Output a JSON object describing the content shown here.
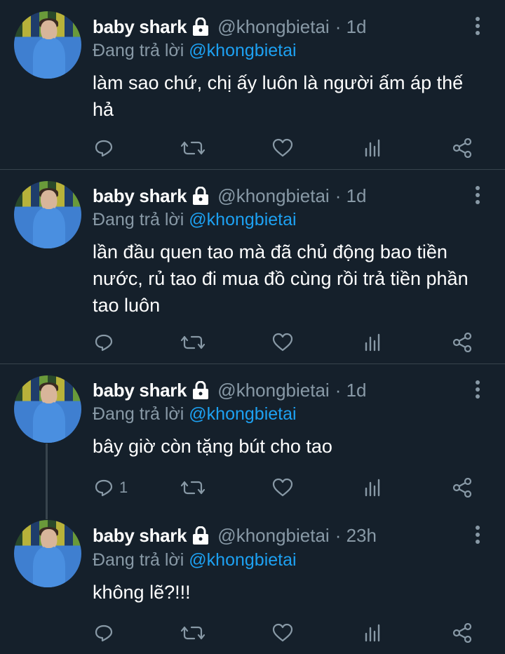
{
  "tweets": [
    {
      "name": "baby shark",
      "handle": "@khongbietai",
      "time": "· 1d",
      "reply_prefix": "Đang trả lời",
      "reply_to": "@khongbietai",
      "text": "làm sao chứ, chị ấy luôn là người ấm áp thế hả",
      "reply_count": ""
    },
    {
      "name": "baby shark",
      "handle": "@khongbietai",
      "time": "· 1d",
      "reply_prefix": "Đang trả lời",
      "reply_to": "@khongbietai",
      "text": "lần đầu quen tao mà đã chủ động bao tiền nước, rủ tao đi mua đồ cùng rồi trả tiền phần tao luôn",
      "reply_count": ""
    },
    {
      "name": "baby shark",
      "handle": "@khongbietai",
      "time": "· 1d",
      "reply_prefix": "Đang trả lời",
      "reply_to": "@khongbietai",
      "text": "bây giờ còn tặng bút cho tao",
      "reply_count": "1"
    },
    {
      "name": "baby shark",
      "handle": "@khongbietai",
      "time": "· 23h",
      "reply_prefix": "Đang trả lời",
      "reply_to": "@khongbietai",
      "text": "không lẽ?!!!",
      "reply_count": ""
    }
  ],
  "icons": {
    "lock": "lock-icon",
    "more": "more-vertical-icon",
    "reply": "reply-icon",
    "retweet": "retweet-icon",
    "like": "heart-icon",
    "analytics": "analytics-icon",
    "share": "share-icon"
  },
  "colors": {
    "background": "#15202b",
    "muted": "#8899a6",
    "link": "#1da1f2",
    "divider": "#38444d"
  }
}
